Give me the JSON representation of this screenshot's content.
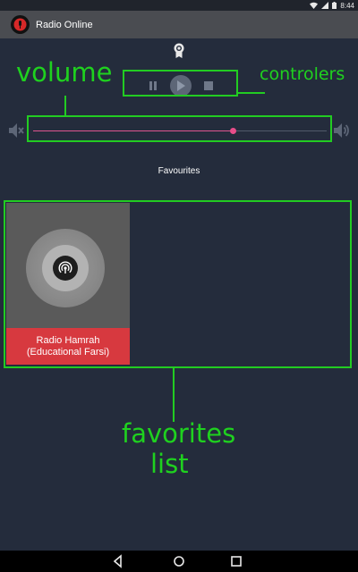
{
  "status_bar": {
    "time": "8:44",
    "icons": [
      "wifi-icon",
      "signal-icon",
      "battery-icon"
    ]
  },
  "app_bar": {
    "title": "Radio Online",
    "logo_icon": "radio-logo-icon"
  },
  "player": {
    "top_icon": "award-badge-icon",
    "controls": [
      {
        "name": "pause",
        "icon": "pause-icon"
      },
      {
        "name": "play",
        "icon": "play-icon"
      },
      {
        "name": "stop",
        "icon": "stop-icon"
      }
    ]
  },
  "volume": {
    "level": 0.68,
    "mute_icon": "volume-mute-icon",
    "max_icon": "volume-up-icon"
  },
  "favourites": {
    "title": "Favourites",
    "items": [
      {
        "name_line1": "Radio Hamrah",
        "name_line2": "(Educational Farsi)",
        "icon": "broadcast-icon"
      }
    ]
  },
  "annotations": {
    "volume": "volume",
    "controllers": "controlers",
    "favorites_line1": "favorites",
    "favorites_line2": "list"
  },
  "nav_bar": {
    "buttons": [
      "back-icon",
      "home-icon",
      "recents-icon"
    ]
  },
  "colors": {
    "background": "#242c3c",
    "app_bar": "#4a4c51",
    "accent_pink": "#e84e8a",
    "card_label_red": "#d7393f",
    "annotation_green": "#22cc22"
  }
}
